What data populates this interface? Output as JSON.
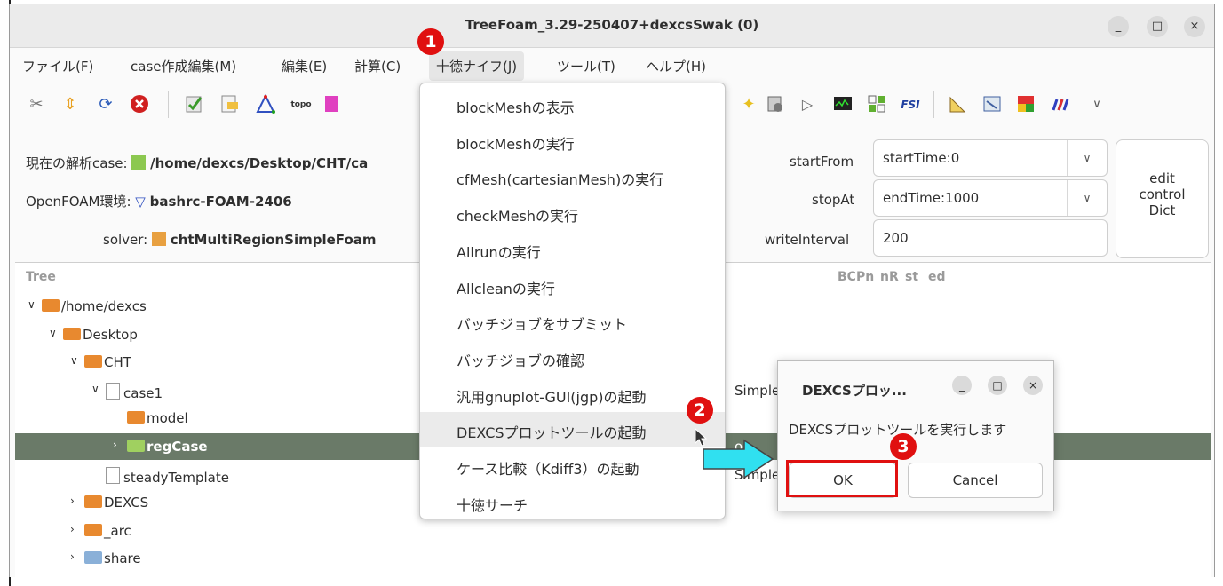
{
  "window": {
    "title": "TreeFoam_3.29-250407+dexcsSwak (0)",
    "controls": [
      "_",
      "□",
      "×"
    ]
  },
  "menubar": [
    "ファイル(F)",
    "case作成編集(M)",
    "編集(E)",
    "計算(C)",
    "十徳ナイフ(J)",
    "ツール(T)",
    "ヘルプ(H)"
  ],
  "toolbar": {
    "icons": [
      "tools-icon",
      "up-down-icon",
      "refresh-icon",
      "stop-icon",
      "check-icon",
      "edit-icon",
      "triangle-icon",
      "topo-icon",
      "mesh-icon",
      "bulb-icon",
      "settings-icon",
      "play-icon",
      "monitor-icon",
      "grid-icon",
      "fsi-icon",
      "ruler-icon",
      "view-icon",
      "vtk-icon",
      "paraview-icon",
      "chevron-down-icon"
    ],
    "labels": {
      "topo": "topo",
      "fsi": "FSI"
    }
  },
  "info": {
    "case_label": "現在の解析case:",
    "case_path": "/home/dexcs/Desktop/CHT/ca",
    "env_label": "OpenFOAM環境:",
    "env_value": "bashrc-FOAM-2406",
    "solver_label": "solver:",
    "solver_value": "chtMultiRegionSimpleFoam"
  },
  "controls": {
    "startFrom_label": "startFrom",
    "startFrom_value": "startTime:0",
    "stopAt_label": "stopAt",
    "stopAt_value": "endTime:1000",
    "writeInterval_label": "writeInterval",
    "writeInterval_value": "200",
    "edit_button": [
      "edit",
      "control",
      "Dict"
    ]
  },
  "tree": {
    "header": "Tree",
    "columns": [
      "BCPn",
      "nR",
      "st",
      "ed"
    ],
    "rows": [
      {
        "label": "/home/dexcs",
        "chev": "∨",
        "type": "folder"
      },
      {
        "label": "Desktop",
        "chev": "∨",
        "type": "folder"
      },
      {
        "label": "CHT",
        "chev": "∨",
        "type": "folder"
      },
      {
        "label": "case1",
        "chev": "∨",
        "type": "file",
        "extra": "Simple"
      },
      {
        "label": "model",
        "chev": "",
        "type": "folder"
      },
      {
        "label": "regCase",
        "chev": "›",
        "type": "check",
        "extra": "ol"
      },
      {
        "label": "steadyTemplate",
        "chev": "",
        "type": "file",
        "extra": "Simple"
      },
      {
        "label": "DEXCS",
        "chev": "›",
        "type": "folder"
      },
      {
        "label": "_arc",
        "chev": "›",
        "type": "folder"
      },
      {
        "label": "share",
        "chev": "›",
        "type": "share"
      }
    ]
  },
  "dropdown_menu": [
    "blockMeshの表示",
    "blockMeshの実行",
    "cfMesh(cartesianMesh)の実行",
    "checkMeshの実行",
    "Allrunの実行",
    "Allcleanの実行",
    "バッチジョブをサブミット",
    "バッチジョブの確認",
    "汎用gnuplot-GUI(jgp)の起動",
    "DEXCSプロットツールの起動",
    "ケース比較（Kdiff3）の起動",
    "十徳サーチ"
  ],
  "dialog": {
    "title": "DEXCSプロッ...",
    "message": "DEXCSプロットツールを実行します",
    "ok": "OK",
    "cancel": "Cancel"
  },
  "badges": [
    "1",
    "2",
    "3"
  ],
  "colors": {
    "badge": "#e01010",
    "selection": "#6a7a68",
    "arrow": "#30e0f0"
  }
}
